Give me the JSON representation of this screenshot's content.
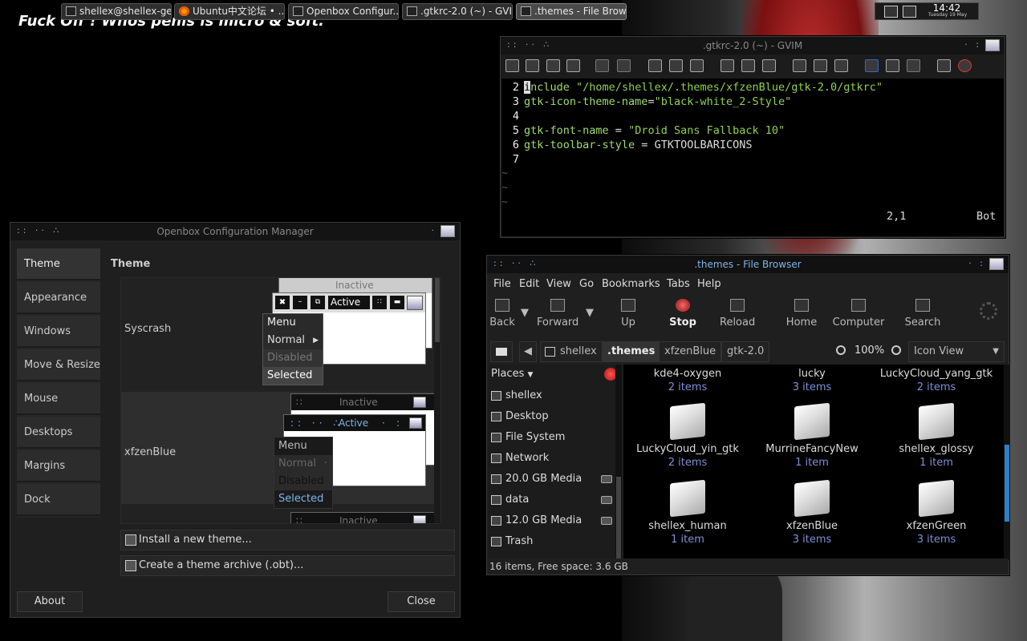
{
  "desktop": {
    "slogan": "Fuck Off ! Whos penis is micro & soft."
  },
  "panel": {
    "tasks": [
      {
        "label": "shellex@shellex-ge...",
        "icon": "terminal-icon"
      },
      {
        "label": "Ubuntu中文论坛 • ...",
        "icon": "firefox-icon"
      },
      {
        "label": "Openbox Configur...",
        "icon": "openbox-icon"
      },
      {
        "label": ".gtkrc-2.0 (~) - GVIM",
        "icon": "gvim-icon"
      },
      {
        "label": ".themes - File Brow...",
        "icon": "folder-icon"
      }
    ],
    "clock_time": "14:42",
    "clock_date": "Tuesday 19 May"
  },
  "ocm": {
    "title": "Openbox Configuration Manager",
    "sidebar": [
      "Theme",
      "Appearance",
      "Windows",
      "Move & Resize",
      "Mouse",
      "Desktops",
      "Margins",
      "Dock"
    ],
    "page_title": "Theme",
    "themes": [
      {
        "name": "Syscrash",
        "inactive": "Inactive",
        "active": "Active",
        "menu": "Menu",
        "normal": "Normal",
        "disabled": "Disabled",
        "selected": "Selected"
      },
      {
        "name": "xfzenBlue",
        "inactive": "Inactive",
        "active": "Active",
        "menu": "Menu",
        "normal": "Normal",
        "disabled": "Disabled",
        "selected": "Selected"
      },
      {
        "inactive": "Inactive"
      }
    ],
    "install_label": "Install a new theme...",
    "archive_label": "Create a theme archive (.obt)...",
    "about_label": "About",
    "close_label": "Close"
  },
  "gvim": {
    "title": ".gtkrc-2.0 (~) - GVIM",
    "lines": [
      {
        "num": "2",
        "cursor": "i",
        "key": "nclude ",
        "val": "\"/home/shellex/.themes/xfzenBlue/gtk-2.0/gtkrc\""
      },
      {
        "num": "3",
        "key": "gtk-icon-theme-name",
        "op": "=",
        "val": "\"black-white_2-Style\""
      },
      {
        "num": "4"
      },
      {
        "num": "5",
        "key": "gtk-font-name",
        "op": " = ",
        "val": "\"Droid Sans Fallback 10\""
      },
      {
        "num": "6",
        "key": "gtk-toolbar-style",
        "op": " = ",
        "plain": "GTKTOOLBARICONS"
      },
      {
        "num": "7"
      }
    ],
    "tildes": [
      "~",
      "~",
      "~"
    ],
    "status_pos": "2,1",
    "status_scroll": "Bot"
  },
  "fb": {
    "title": ".themes - File Browser",
    "menu": [
      "File",
      "Edit",
      "View",
      "Go",
      "Bookmarks",
      "Tabs",
      "Help"
    ],
    "toolbar": [
      "Back",
      "Forward",
      "Up",
      "Stop",
      "Reload",
      "Home",
      "Computer",
      "Search"
    ],
    "path": [
      "shellex",
      ".themes",
      "xfzenBlue",
      "gtk-2.0"
    ],
    "zoom": "100%",
    "view_mode": "Icon View",
    "places_label": "Places",
    "places": [
      {
        "name": "shellex"
      },
      {
        "name": "Desktop"
      },
      {
        "name": "File System"
      },
      {
        "name": "Network"
      },
      {
        "name": "20.0 GB Media",
        "eject": true
      },
      {
        "name": "data",
        "eject": true
      },
      {
        "name": "12.0 GB Media",
        "eject": true
      },
      {
        "name": "Trash"
      }
    ],
    "items": [
      {
        "name": "kde4-oxygen",
        "count": "2 items"
      },
      {
        "name": "lucky",
        "count": "3 items"
      },
      {
        "name": "LuckyCloud_yang_gtk",
        "count": "2 items"
      },
      {
        "name": "LuckyCloud_yin_gtk",
        "count": "2 items"
      },
      {
        "name": "MurrineFancyNew",
        "count": "1 item"
      },
      {
        "name": "shellex_glossy",
        "count": "1 item"
      },
      {
        "name": "shellex_human",
        "count": "1 item"
      },
      {
        "name": "xfzenBlue",
        "count": "3 items"
      },
      {
        "name": "xfzenGreen",
        "count": "3 items"
      }
    ],
    "status": "16 items, Free space: 3.6 GB"
  }
}
